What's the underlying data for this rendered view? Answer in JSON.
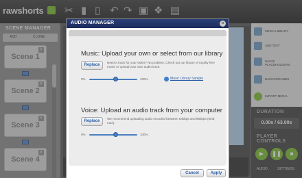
{
  "app": {
    "logo_text": "rawshorts"
  },
  "scene_manager": {
    "title": "SCENE MANAGER",
    "add_label": "ADD",
    "clone_label": "CLONE",
    "scenes": [
      "Scene 1",
      "Scene 2",
      "Scene 3",
      "Scene 4"
    ]
  },
  "right_panel": {
    "items": [
      "MEDIA LIBRARY",
      "ADD TEXT",
      "IMAGE PLACEHOLDERS",
      "BACKGROUNDS",
      "IMPORT MEDIA"
    ],
    "duration_heading": "DURATION",
    "duration_value": "0.00s / 63.00s",
    "player_heading": "PLAYER CONTROLS",
    "audio_label": "AUDIO",
    "settings_label": "SETTINGS"
  },
  "modal": {
    "title": "AUDIO MANAGER",
    "close_symbol": "×",
    "music": {
      "heading": "Music: Upload your own or select from our library",
      "replace_label": "Replace",
      "description": "Need a track for your video? No problem. Check out our library of royalty free music or upload your own audio track.",
      "volume_min": "0%",
      "volume_max": "100%",
      "volume_level_percent": 55,
      "library_link": "Music Library Sample"
    },
    "voice": {
      "heading": "Voice: Upload an audio track from your computer",
      "replace_label": "Replace",
      "description": "We recommend uploading audio encoded between 64kbps and 96kbps (8mb max).",
      "volume_min": "0%",
      "volume_max": "100%",
      "volume_level_percent": 55
    },
    "cancel_label": "Cancel",
    "apply_label": "Apply"
  },
  "colors": {
    "modal_header": "#1c2c5c",
    "accent_blue": "#2c5fa8",
    "play_green": "#8bc34a"
  }
}
